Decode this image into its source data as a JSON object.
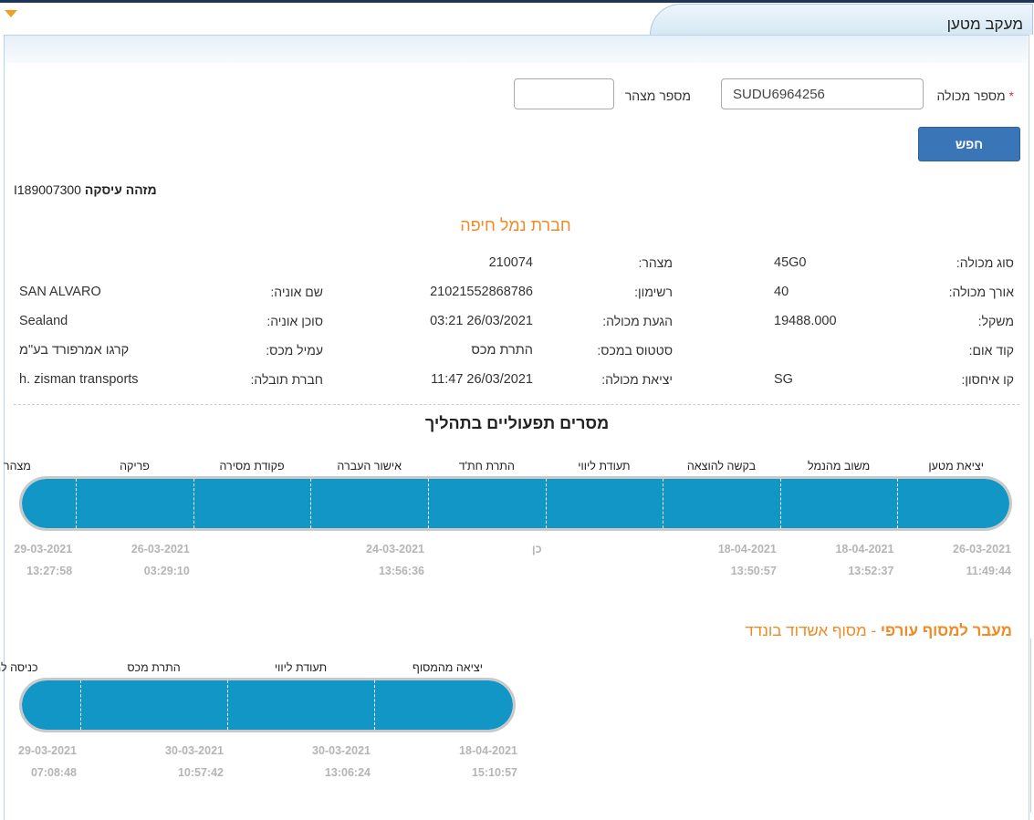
{
  "header": {
    "title": "מעקב מטען"
  },
  "search": {
    "container_label": "מספר מכולה",
    "required_mark": "*",
    "container_value": "SUDU6964256",
    "manifest_label": "מספר מצהר",
    "manifest_value": "",
    "button_label": "חפש"
  },
  "transaction": {
    "label": "מזהה עיסקה",
    "value": "I189007300"
  },
  "company": "חברת נמל חיפה",
  "details": {
    "col1": [
      {
        "label": "סוג מכולה:",
        "value": "45G0"
      },
      {
        "label": "אורך מכולה:",
        "value": "40"
      },
      {
        "label": "משקל:",
        "value": "19488.000"
      },
      {
        "label": "קוד אום:",
        "value": ""
      },
      {
        "label": "קו איחסון:",
        "value": "SG"
      }
    ],
    "col2": [
      {
        "label": "מצהר:",
        "value": "210074"
      },
      {
        "label": "רשימון:",
        "value": "21021552868786"
      },
      {
        "label": "הגעת מכולה:",
        "value": "26/03/2021 03:21"
      },
      {
        "label": "סטטוס במכס:",
        "value": "התרת מכס"
      },
      {
        "label": "יציאת מכולה:",
        "value": "26/03/2021 11:47"
      }
    ],
    "col3": [
      {
        "label": "",
        "value": ""
      },
      {
        "label": "שם אוניה:",
        "value": "SAN ALVARO"
      },
      {
        "label": "סוכן אוניה:",
        "value": "Sealand"
      },
      {
        "label": "עמיל מכס:",
        "value": "קרגו אמרפורד בע\"מ"
      },
      {
        "label": "חברת תובלה:",
        "value": "h. zisman transports"
      }
    ]
  },
  "process": {
    "title": "מסרים תפעוליים בתהליך",
    "stages": [
      {
        "label": "יציאת מטען",
        "date": "26-03-2021",
        "time": "11:49:44"
      },
      {
        "label": "משוב מהנמל",
        "date": "18-04-2021",
        "time": "13:52:37"
      },
      {
        "label": "בקשה להוצאה",
        "date": "18-04-2021",
        "time": "13:50:57"
      },
      {
        "label": "תעודת ליווי",
        "date": "",
        "time": ""
      },
      {
        "label": "התרת חת'ד",
        "date": "כן",
        "time": ""
      },
      {
        "label": "אישור העברה",
        "date": "24-03-2021",
        "time": "13:56:36"
      },
      {
        "label": "פקודת מסירה",
        "date": "",
        "time": ""
      },
      {
        "label": "פריקה",
        "date": "26-03-2021",
        "time": "03:29:10"
      },
      {
        "label": "מצהר",
        "date": "29-03-2021",
        "time": "13:27:58"
      }
    ]
  },
  "terminal": {
    "title_bold": "מעבר למסוף עורפי",
    "title_dash": " - ",
    "title_name": "מסוף אשדוד בונדד",
    "stages": [
      {
        "label": "יציאה מהמסוף",
        "date": "18-04-2021",
        "time": "15:10:57"
      },
      {
        "label": "תעודת ליווי",
        "date": "30-03-2021",
        "time": "13:06:24"
      },
      {
        "label": "התרת מכס",
        "date": "30-03-2021",
        "time": "10:57:42"
      },
      {
        "label": "כניסה למסוף",
        "date": "29-03-2021",
        "time": "07:08:48"
      }
    ]
  }
}
